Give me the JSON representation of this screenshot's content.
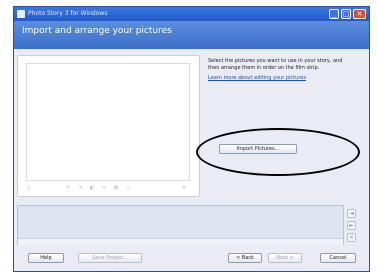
{
  "window": {
    "title": "Photo Story 3 for Windows"
  },
  "header": {
    "title": "Import and arrange your pictures"
  },
  "preview": {
    "controls": [
      "◁",
      "↶",
      "↷",
      "◐",
      "✂",
      "⊠",
      "▭",
      "✕"
    ]
  },
  "right_pane": {
    "instructions": "Select the pictures you want to use in your story, and then arrange them in order on the film strip.",
    "link": "Learn more about editing your pictures"
  },
  "import_button": {
    "label": "Import Pictures..."
  },
  "side_buttons": [
    "◄",
    "►",
    "✕"
  ],
  "footer": {
    "help": "Help",
    "save_project": "Save Project...",
    "back": "< Back",
    "next": "Next >",
    "cancel": "Cancel"
  }
}
